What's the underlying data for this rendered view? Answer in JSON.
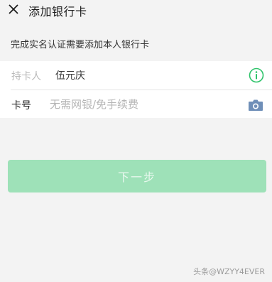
{
  "header": {
    "title": "添加银行卡",
    "close_icon": "close-icon"
  },
  "subtitle": "完成实名认证需要添加本人银行卡",
  "form": {
    "holder_label": "持卡人",
    "holder_value": "伍元庆",
    "holder_info_icon": "info-icon",
    "card_label": "卡号",
    "card_placeholder": "无需网银/免手续费",
    "card_camera_icon": "camera-icon"
  },
  "next_button_label": "下一步",
  "watermark": "头条@WZYY4EVER",
  "colors": {
    "accent_green": "#2ec36a",
    "button_disabled_green": "#9ee1b8",
    "camera_blue": "#6f8fb8"
  }
}
